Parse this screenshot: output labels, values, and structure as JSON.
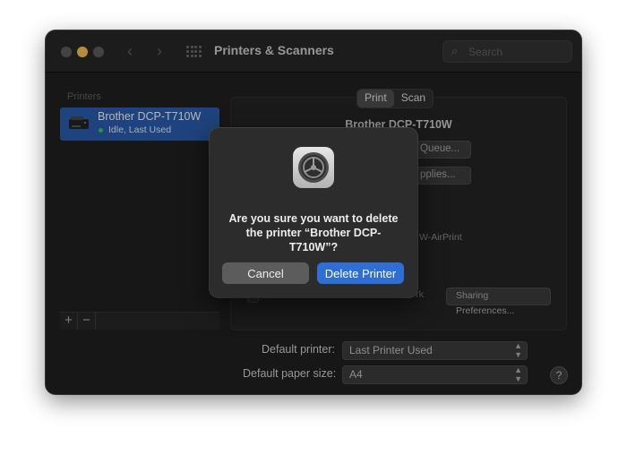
{
  "window": {
    "title": "Printers & Scanners",
    "search_placeholder": "Search"
  },
  "sidebar": {
    "section_label": "Printers",
    "printers": [
      {
        "name": "Brother DCP-T710W",
        "status": "Idle, Last Used",
        "status_color": "#2fc65a"
      }
    ],
    "add_label": "+",
    "remove_label": "−"
  },
  "detail": {
    "tabs": [
      {
        "label": "Print",
        "active": true
      },
      {
        "label": "Scan",
        "active": false
      }
    ],
    "printer_name": "Brother DCP-T710W",
    "open_queue_label": "Queue...",
    "supplies_label": "pplies...",
    "kind_text": "W-AirPrint",
    "share_text": "rk",
    "sharing_prefs_label": "Sharing Preferences..."
  },
  "settings": {
    "default_printer_label": "Default printer:",
    "default_printer_value": "Last Printer Used",
    "paper_size_label": "Default paper size:",
    "paper_size_value": "A4",
    "help_label": "?"
  },
  "dialog": {
    "message": "Are you sure you want to delete the printer “Brother DCP-T710W”?",
    "cancel_label": "Cancel",
    "delete_label": "Delete Printer",
    "icon": "system-settings-gear-icon"
  },
  "colors": {
    "accent": "#2f6fd5",
    "selection": "#2a5aa8",
    "window_bg": "#1f1f1f"
  }
}
